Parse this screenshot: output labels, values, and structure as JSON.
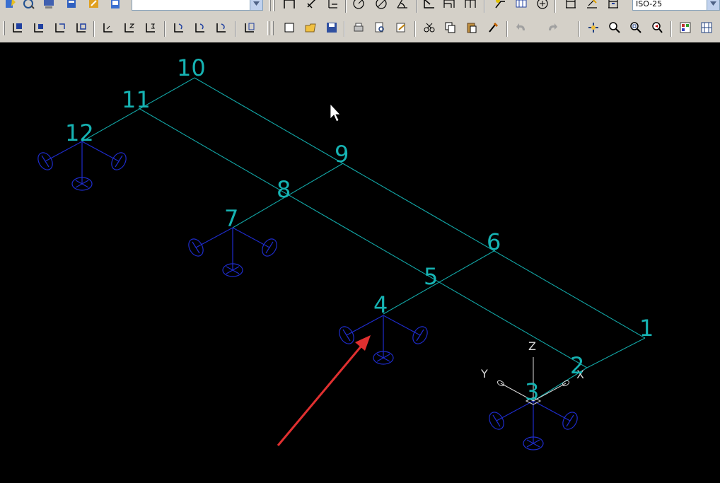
{
  "window": {
    "title": ""
  },
  "toolbar": {
    "dim_style_value": "ISO-25",
    "layer_combo_value": "",
    "row1_icons": [
      "properties-icon",
      "match-icon",
      "design-center-icon",
      "tool-palettes-icon",
      "markup-icon",
      "sheet-set-icon"
    ],
    "row1_dim_icons": [
      "linear-dimension-icon",
      "aligned-dimension-icon",
      "ordinate-dimension-icon",
      "radius-dimension-icon",
      "diameter-dimension-icon",
      "angular-dimension-icon",
      "quick-dimension-icon",
      "baseline-dimension-icon",
      "continue-dimension-icon",
      "leader-icon",
      "tolerance-icon",
      "center-mark-icon",
      "dimension-edit-icon",
      "dimension-text-edit-icon",
      "dimension-update-icon"
    ],
    "row2_ucs_icons": [
      "ucs-world-icon",
      "ucs-object-icon",
      "ucs-face-icon",
      "ucs-view-icon",
      "ucs-origin-icon",
      "ucs-zaxis-icon",
      "ucs-3point-icon",
      "ucs-x-icon",
      "ucs-y-icon",
      "ucs-z-icon",
      "ucs-apply-icon"
    ],
    "row2_std_icons": [
      "new-icon",
      "open-icon",
      "save-icon",
      "plot-icon",
      "plot-preview-icon",
      "publish-icon",
      "cut-icon",
      "copy-icon",
      "paste-icon",
      "match-properties-icon",
      "undo-icon",
      "redo-icon",
      "pan-icon",
      "zoom-realtime-icon",
      "zoom-window-icon",
      "zoom-previous-icon",
      "properties-palette-icon",
      "design-center-palette-icon"
    ]
  },
  "drawing": {
    "colors": {
      "background": "#000000",
      "lines": "#12a6a6",
      "labels": "#16b3b3",
      "supports": "#1e2ccc",
      "ucs": "#d8d8d8",
      "arrow": "#e03030"
    },
    "node_labels": [
      "1",
      "2",
      "3",
      "4",
      "5",
      "6",
      "7",
      "8",
      "9",
      "10",
      "11",
      "12"
    ],
    "ucs_labels": {
      "x": "X",
      "y": "Y",
      "z": "Z"
    }
  }
}
